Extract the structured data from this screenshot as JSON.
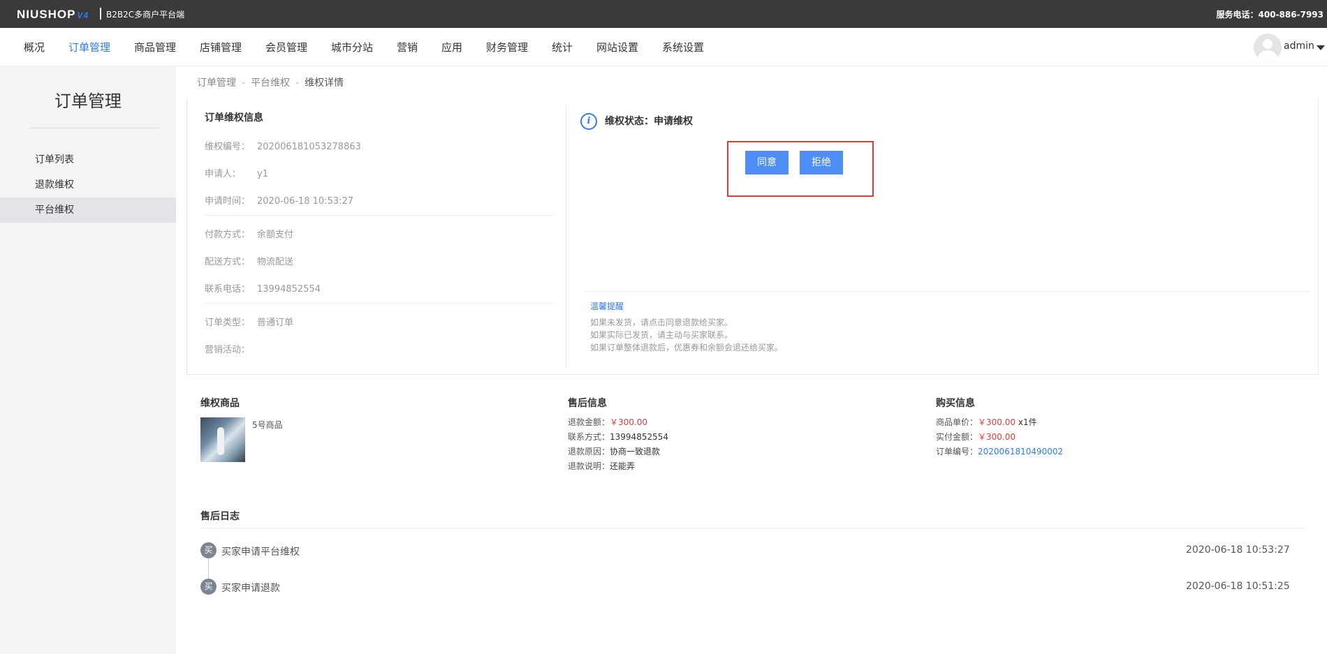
{
  "topbar": {
    "logo": "NIUSHOP",
    "logo_version": "V4",
    "subtitle": "B2B2C多商户平台端",
    "hotline": "服务电话：400-886-7993"
  },
  "nav": {
    "items": [
      "概况",
      "订单管理",
      "商品管理",
      "店铺管理",
      "会员管理",
      "城市分站",
      "营销",
      "应用",
      "财务管理",
      "统计",
      "网站设置",
      "系统设置"
    ],
    "active": "订单管理",
    "user": "admin"
  },
  "sidebar": {
    "title": "订单管理",
    "items": [
      "订单列表",
      "退款维权",
      "平台维权"
    ],
    "active": "平台维权"
  },
  "breadcrumb": [
    "订单管理",
    "平台维权",
    "维权详情"
  ],
  "rights_info": {
    "title": "订单维权信息",
    "rows": [
      {
        "label": "维权编号：",
        "value": "202006181053278863"
      },
      {
        "label": "申请人：",
        "value": "y1"
      },
      {
        "label": "申请时间：",
        "value": "2020-06-18 10:53:27"
      },
      {
        "label": "付款方式：",
        "value": "余额支付"
      },
      {
        "label": "配送方式：",
        "value": "物流配送"
      },
      {
        "label": "联系电话：",
        "value": "13994852554"
      },
      {
        "label": "订单类型：",
        "value": "普通订单"
      },
      {
        "label": "营销活动：",
        "value": ""
      }
    ]
  },
  "status": {
    "icon": "info-icon",
    "text": "维权状态：申请维权",
    "agree_label": "同意",
    "reject_label": "拒绝",
    "tips_title": "温馨提醒",
    "tips": [
      "如果未发货，请点击同意退款给买家。",
      "如果实际已发货，请主动与买家联系。",
      "如果订单整体退款后，优惠券和余额会退还给买家。"
    ]
  },
  "goods": {
    "title": "维权商品",
    "name": "5号商品"
  },
  "after_sale": {
    "title": "售后信息",
    "refund_amount_label": "退款金额：",
    "refund_amount": "￥300.00",
    "contact_label": "联系方式：",
    "contact": "13994852554",
    "reason_label": "退款原因：",
    "reason": "协商一致退款",
    "remark_label": "退款说明：",
    "remark": "还能弄"
  },
  "purchase": {
    "title": "购买信息",
    "unit_price_label": "商品单价：",
    "unit_price": "￥300.00",
    "quantity": "x1件",
    "paid_label": "实付金额：",
    "paid": "￥300.00",
    "order_no_label": "订单编号：",
    "order_no": "2020061810490002"
  },
  "log": {
    "title": "售后日志",
    "entries": [
      {
        "badge": "买",
        "text": "买家申请平台维权",
        "time": "2020-06-18 10:53:27"
      },
      {
        "badge": "买",
        "text": "买家申请退款",
        "time": "2020-06-18 10:51:25"
      }
    ]
  },
  "colors": {
    "accent": "#2f7bf5",
    "button": "#4e8ef7",
    "highlight_box": "#e53935",
    "price": "#e4393c",
    "topbar": "#3a3a3a"
  }
}
